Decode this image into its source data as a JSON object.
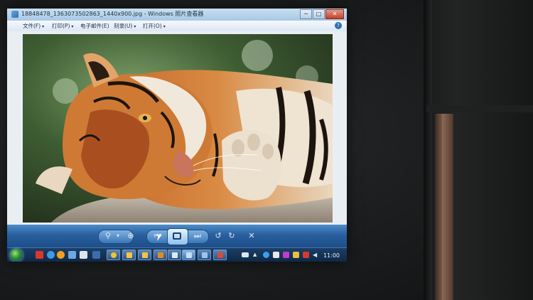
{
  "window": {
    "title": "18848478_1363073502863_1440x900.jpg - Windows 照片查看器",
    "min_symbol": "─",
    "max_symbol": "□",
    "close_symbol": "✕"
  },
  "menu": {
    "items": [
      "文件(F)",
      "打印(P)",
      "电子邮件(E)",
      "刻录(U)",
      "打开(O)"
    ],
    "help_symbol": "?"
  },
  "viewer": {
    "image_subject": "tiger lying on rock"
  },
  "controls": {
    "zoom_symbol": "⚲",
    "fit_symbol": "⊕",
    "prev_symbol": "⏮",
    "next_symbol": "⏭",
    "rotate_left_symbol": "↺",
    "rotate_right_symbol": "↻",
    "delete_symbol": "✕",
    "zoom_caret": "▾"
  },
  "taskbar": {
    "clock": "11:00"
  },
  "colors": {
    "controls_bar": "#2a5f9e",
    "taskbar": "#0f2745",
    "title_bar": "#b8d3ec"
  }
}
